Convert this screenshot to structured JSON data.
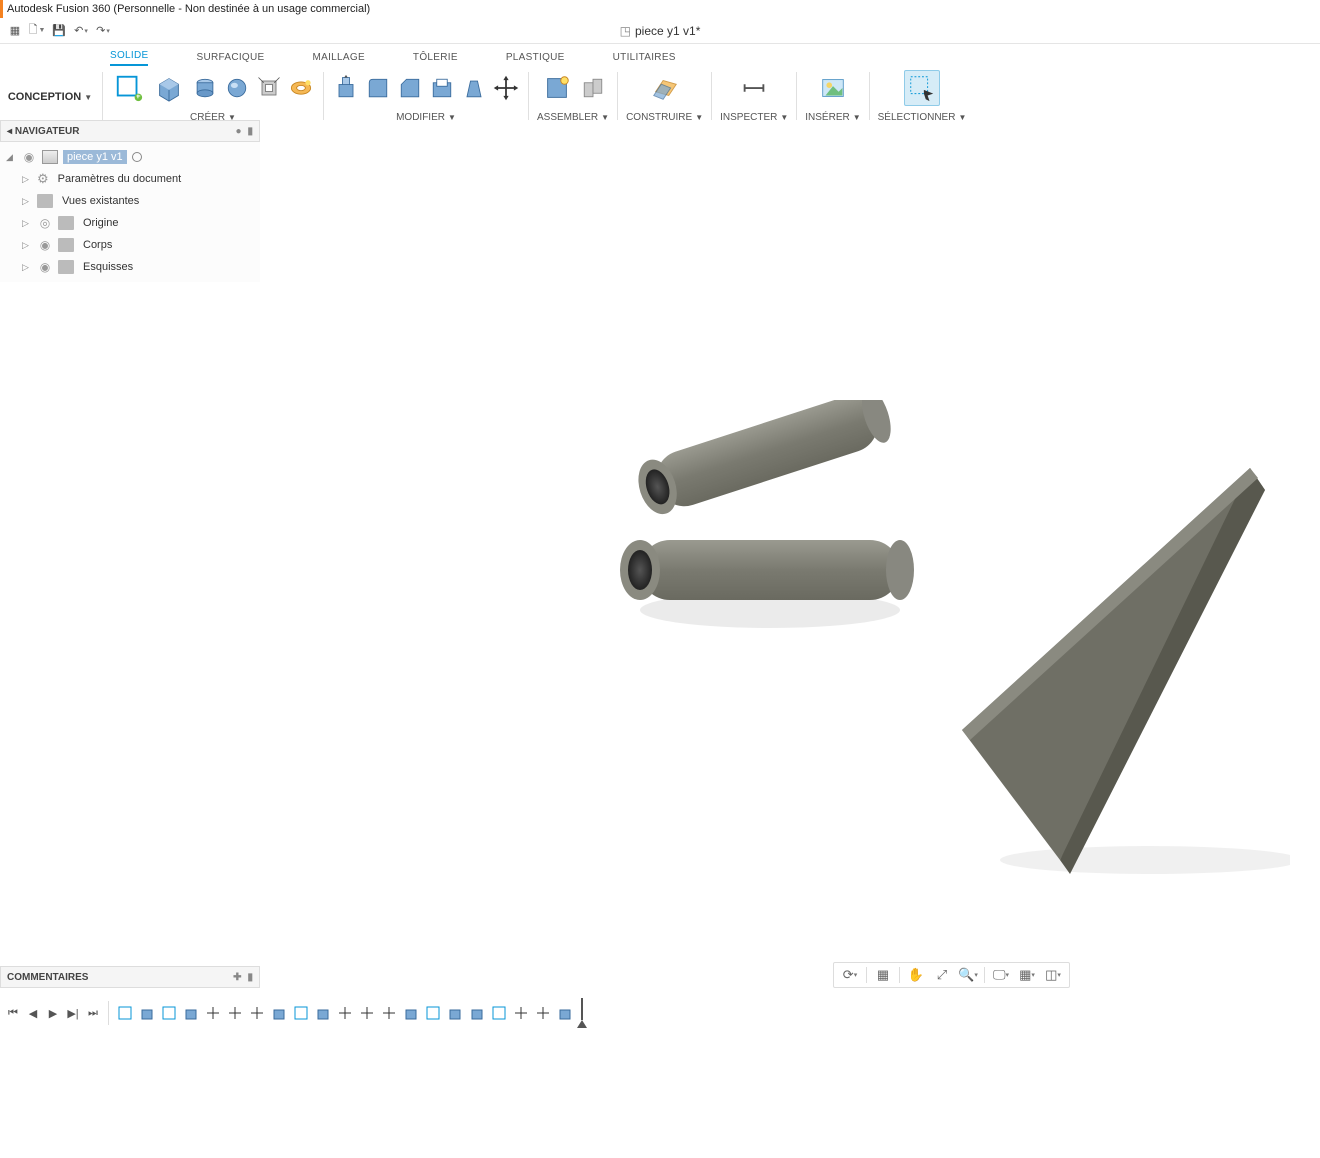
{
  "title": "Autodesk Fusion 360 (Personnelle - Non destinée à un usage commercial)",
  "doc_tab": {
    "name": "piece y1 v1*"
  },
  "workspace": "CONCEPTION",
  "ribbon_tabs": [
    "SOLIDE",
    "SURFACIQUE",
    "MAILLAGE",
    "TÔLERIE",
    "PLASTIQUE",
    "UTILITAIRES"
  ],
  "ribbon_active": 0,
  "groups": {
    "create": "CRÉER",
    "modify": "MODIFIER",
    "assemble": "ASSEMBLER",
    "construct": "CONSTRUIRE",
    "inspect": "INSPECTER",
    "insert": "INSÉRER",
    "select": "SÉLECTIONNER"
  },
  "browser": {
    "title": "NAVIGATEUR",
    "root": "piece y1 v1",
    "items": [
      "Paramètres du document",
      "Vues existantes",
      "Origine",
      "Corps",
      "Esquisses"
    ]
  },
  "comments": "COMMENTAIRES"
}
